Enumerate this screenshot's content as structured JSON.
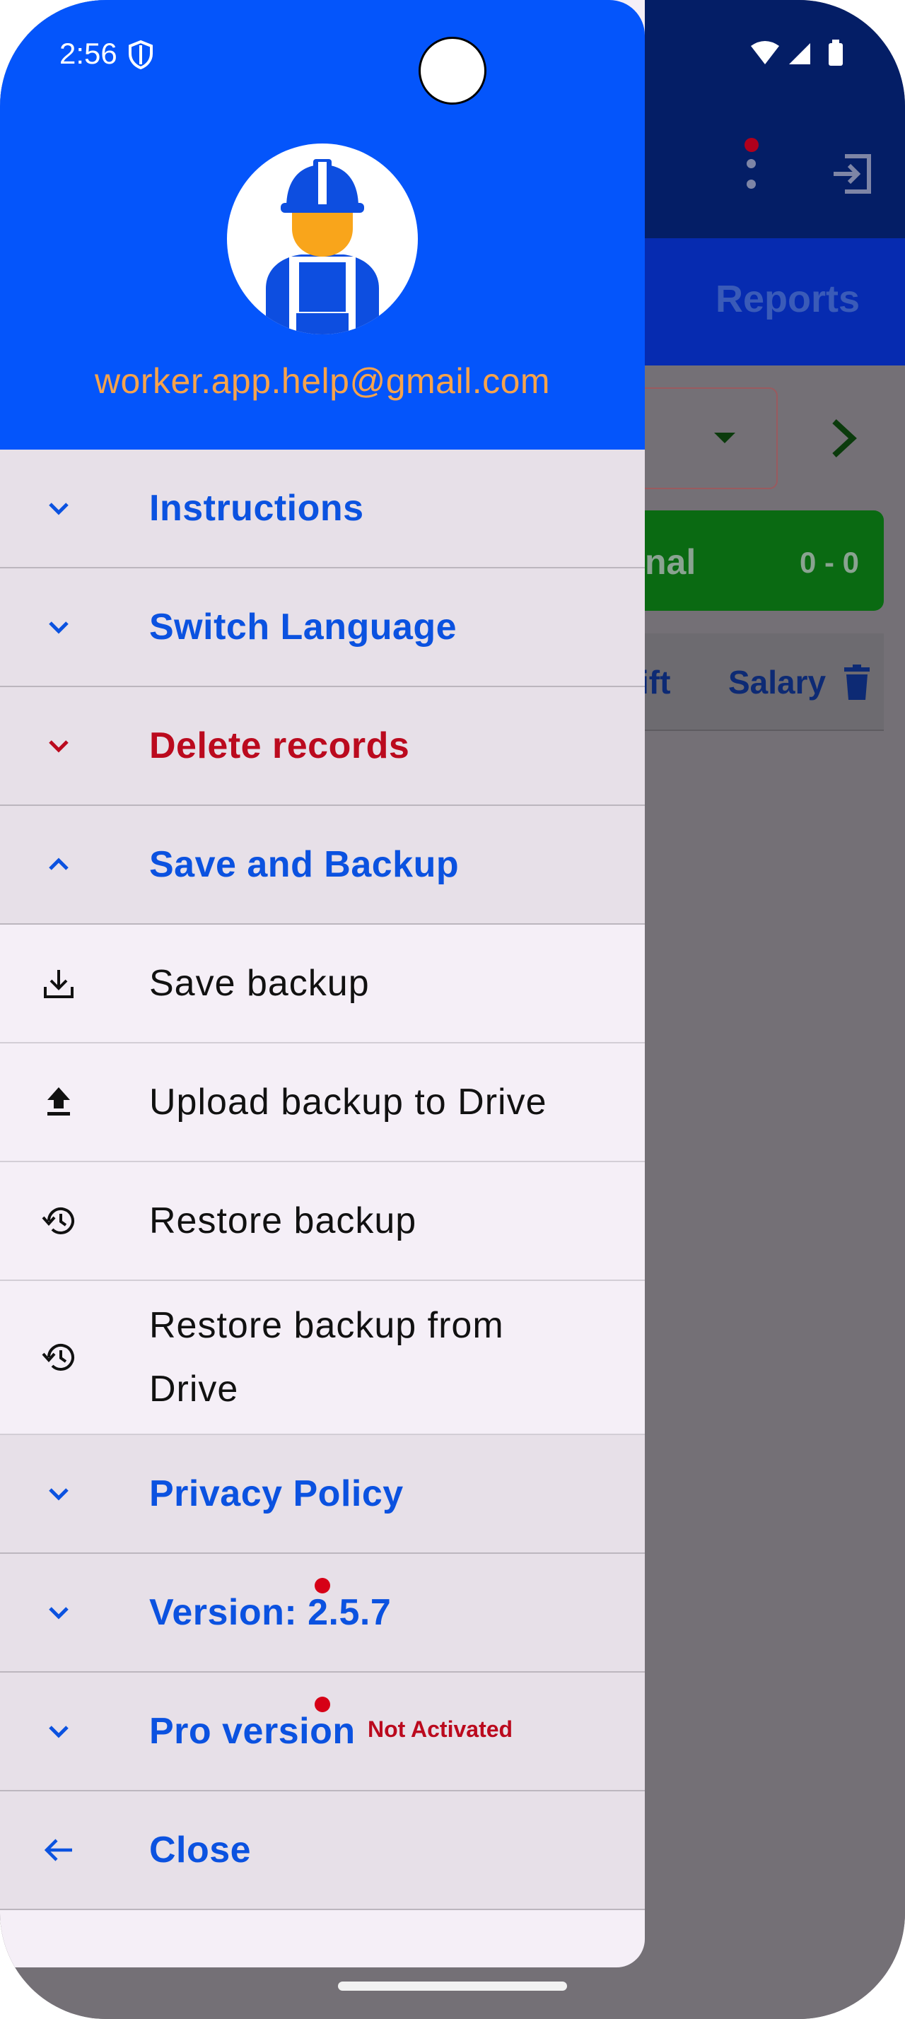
{
  "status_bar": {
    "time": "2:56"
  },
  "drawer_header": {
    "email": "worker.app.help@gmail.com"
  },
  "menu": {
    "instructions": "Instructions",
    "switch_language": "Switch Language",
    "delete_records": "Delete records",
    "save_and_backup": "Save and Backup",
    "save_backup": "Save backup",
    "upload_backup": "Upload backup to Drive",
    "restore_backup": "Restore backup",
    "restore_backup_drive": "Restore backup from Drive",
    "privacy_policy": "Privacy Policy",
    "version": "Version:  2.5.7",
    "pro_version": "Pro version",
    "pro_status": "Not Activated",
    "close": "Close"
  },
  "background_app": {
    "tab_reports": "Reports",
    "green_left": "nal",
    "green_right": "0 - 0",
    "col_shift": "ift",
    "col_salary": "Salary"
  },
  "colors": {
    "accent": "#0455fb",
    "label_blue": "#0b52e0",
    "danger": "#bb0a1e",
    "email": "#f7a34b"
  }
}
